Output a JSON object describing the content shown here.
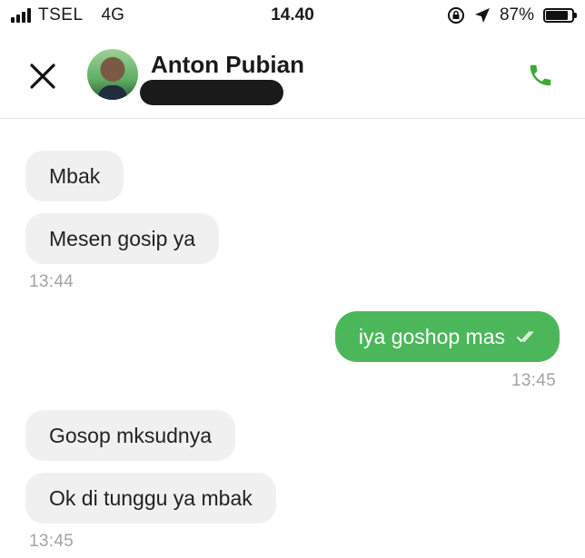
{
  "status_bar": {
    "carrier": "TSEL",
    "network": "4G",
    "time": "14.40",
    "battery": "87%",
    "battery_level": 0.87
  },
  "header": {
    "contact_name": "Anton Pubian",
    "close_icon": "close-icon",
    "call_icon": "phone-icon",
    "accent_color": "#3aaa35"
  },
  "messages": [
    {
      "direction": "in",
      "text": "Mbak"
    },
    {
      "direction": "in",
      "text": "Mesen gosip ya",
      "time": "13:44"
    },
    {
      "direction": "out",
      "text": "iya goshop mas",
      "time": "13:45",
      "status_icon": "double-check-icon"
    },
    {
      "direction": "in",
      "text": "Gosop mksudnya"
    },
    {
      "direction": "in",
      "text": "Ok di tunggu ya mbak",
      "time": "13:45"
    }
  ],
  "colors": {
    "outgoing_bubble": "#4cb65b",
    "incoming_bubble": "#f0f0f0",
    "timestamp": "#a3a3a3"
  }
}
